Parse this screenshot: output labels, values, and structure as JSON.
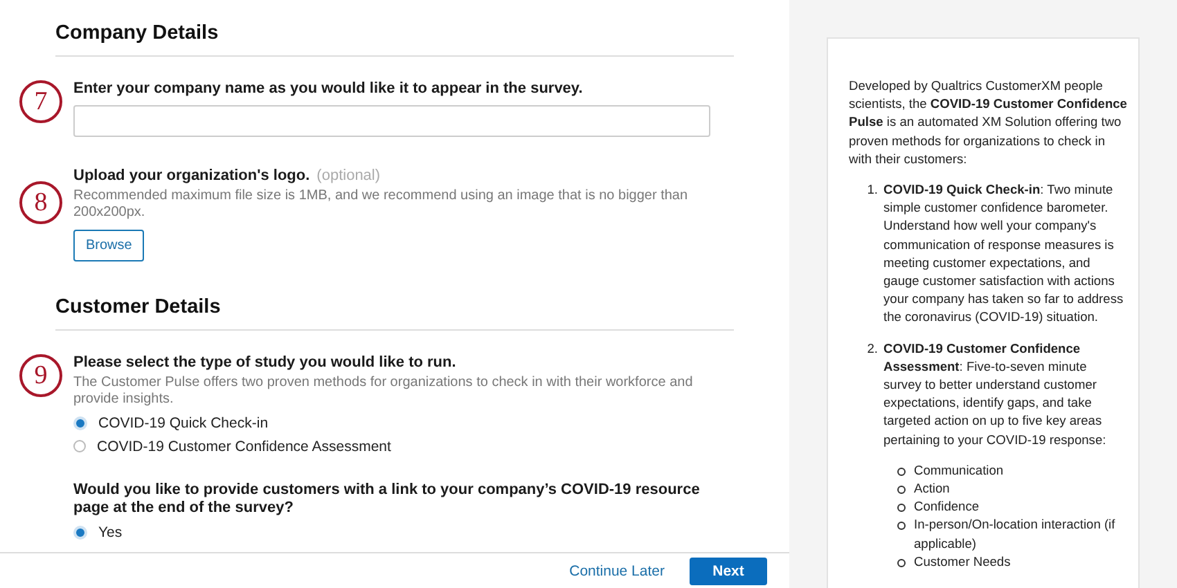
{
  "sections": [
    {
      "heading": "Company Details",
      "questions": [
        {
          "kind": "text",
          "marker": "7",
          "prompt": "Enter your company name as you would like it to appear in the survey."
        },
        {
          "kind": "upload",
          "marker": "8",
          "prompt": "Upload your organization's logo.",
          "optional": "(optional)",
          "description": "Recommended maximum file size is 1MB, and we recommend using an image that is no bigger than 200x200px.",
          "button": "Browse"
        }
      ]
    },
    {
      "heading": "Customer Details",
      "questions": [
        {
          "kind": "radio",
          "marker": "9",
          "prompt": "Please select the type of study you would like to run.",
          "description": "The Customer Pulse offers two proven methods for organizations to check in with their workforce and provide insights.",
          "options": [
            {
              "label": "COVID-19 Quick Check-in",
              "selected": true
            },
            {
              "label": "COVID-19 Customer Confidence Assessment",
              "selected": false
            }
          ]
        },
        {
          "kind": "radio",
          "prompt": "Would you like to provide customers with a link to your company’s COVID-19 resource page at the end of the survey?",
          "options": [
            {
              "label": "Yes",
              "selected": true
            }
          ]
        }
      ]
    }
  ],
  "footer": {
    "secondary": "Continue Later",
    "primary": "Next"
  },
  "info": {
    "intro": "Developed by Qualtrics CustomerXM people scientists, the **COVID-19 Customer Confidence Pulse** is an automated XM Solution offering two proven methods for organizations to check in with their customers:",
    "items": [
      {
        "number": "1.",
        "text": "**COVID-19 Quick Check-in**: Two minute simple customer confidence barometer. Understand how well your company's communication of response measures is meeting customer expectations, and gauge customer satisfaction with actions your company has taken so far to address the coronavirus (COVID-19) situation."
      },
      {
        "number": "2.",
        "text": "**COVID-19 Customer Confidence Assessment**: Five-to-seven minute survey to better understand customer expectations, identify gaps, and take targeted action on up to five key areas pertaining to your COVID-19 response:",
        "subitems": [
          "Communication",
          "Action",
          "Confidence",
          "In-person/On-location interaction (if applicable)",
          "Customer Needs"
        ]
      }
    ]
  }
}
